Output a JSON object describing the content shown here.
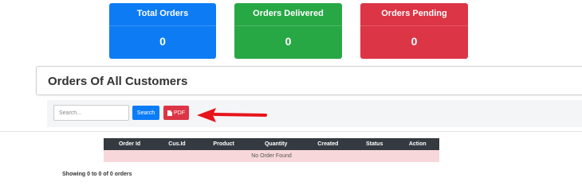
{
  "cards": [
    {
      "title": "Total Orders",
      "value": "0",
      "color": "#0d7cf4"
    },
    {
      "title": "Orders Delivered",
      "value": "0",
      "color": "#28a745"
    },
    {
      "title": "Orders Pending",
      "value": "0",
      "color": "#dc3545"
    }
  ],
  "section": {
    "title": "Orders Of All Customers"
  },
  "toolbar": {
    "search_placeholder": "Search...",
    "search_label": "Search",
    "pdf_label": "PDF"
  },
  "table": {
    "columns": [
      "Order Id",
      "Cus.Id",
      "Product",
      "Quantity",
      "Created",
      "Status",
      "Action"
    ],
    "empty_message": "No Order Found"
  },
  "footer": {
    "showing": "Showing 0 to 0 of 0 orders"
  }
}
